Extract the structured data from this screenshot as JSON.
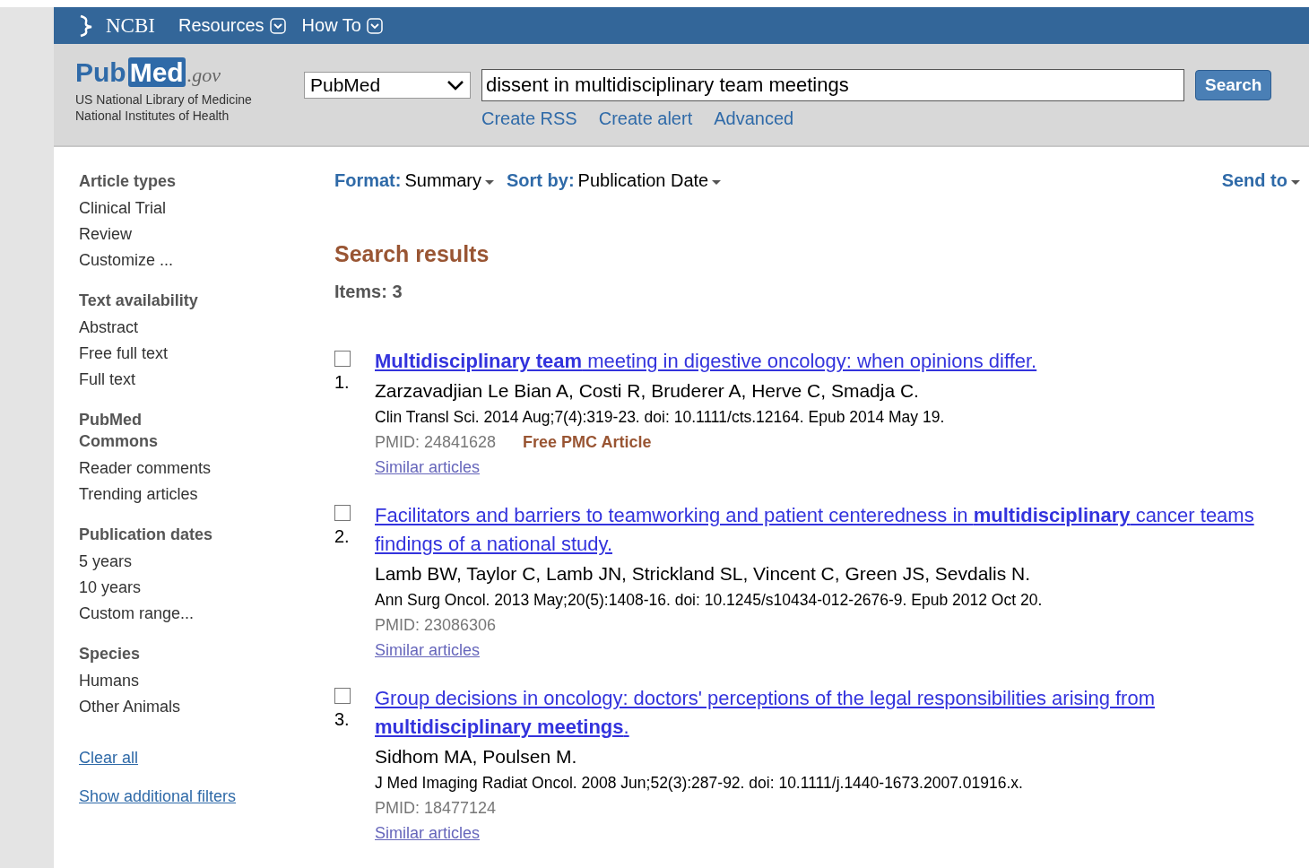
{
  "header": {
    "brand": "NCBI",
    "menus": [
      {
        "label": "Resources"
      },
      {
        "label": "How To"
      }
    ]
  },
  "logo": {
    "name_a": "Pub",
    "name_b": "Med",
    "suffix": ".gov",
    "lines": [
      "US National Library of Medicine",
      "National Institutes of Health"
    ]
  },
  "search": {
    "database": "PubMed",
    "query": "dissent in multidisciplinary team meetings",
    "button": "Search",
    "links": [
      "Create RSS",
      "Create alert",
      "Advanced"
    ]
  },
  "sidebar": {
    "groups": [
      {
        "title": "Article types",
        "items": [
          "Clinical Trial",
          "Review",
          "Customize ..."
        ]
      },
      {
        "title": "Text availability",
        "items": [
          "Abstract",
          "Free full text",
          "Full text"
        ]
      },
      {
        "title": "PubMed Commons",
        "items": [
          "Reader comments",
          "Trending articles"
        ]
      },
      {
        "title": "Publication dates",
        "items": [
          "5 years",
          "10 years",
          "Custom range..."
        ]
      },
      {
        "title": "Species",
        "items": [
          "Humans",
          "Other Animals"
        ]
      }
    ],
    "links": [
      "Clear all",
      "Show additional filters"
    ]
  },
  "toolbar": {
    "format_label": "Format:",
    "format_value": "Summary",
    "sort_label": "Sort by:",
    "sort_value": "Publication Date",
    "send": "Send to"
  },
  "results": {
    "heading": "Search results",
    "count": "Items: 3",
    "items": [
      {
        "number": "1.",
        "checked": false,
        "title": "**Multidisciplinary team** meeting in digestive oncology: when opinions differ.",
        "authors": "Zarzavadjian Le Bian A, Costi R, Bruderer A, Herve C, Smadja C.",
        "citation": "Clin Transl Sci. 2014 Aug;7(4):319-23. doi: 10.1111/cts.12164. Epub 2014 May 19.",
        "pmid": "PMID: 24841628",
        "free": "Free PMC Article",
        "similar": "Similar articles"
      },
      {
        "number": "2.",
        "checked": false,
        "title": "Facilitators and barriers to teamworking and patient centeredness in **multidisciplinary** cancer teams findings of a national study.",
        "authors": "Lamb BW, Taylor C, Lamb JN, Strickland SL, Vincent C, Green JS, Sevdalis N.",
        "citation": "Ann Surg Oncol. 2013 May;20(5):1408-16. doi: 10.1245/s10434-012-2676-9. Epub 2012 Oct 20.",
        "pmid": "PMID: 23086306",
        "similar": "Similar articles"
      },
      {
        "number": "3.",
        "checked": false,
        "title": "Group decisions in oncology: doctors' perceptions of the legal responsibilities arising from **multidisciplinary meetings**.",
        "authors": "Sidhom MA, Poulsen M.",
        "citation": "J Med Imaging Radiat Oncol. 2008 Jun;52(3):287-92. doi: 10.1111/j.1440-1673.2007.01916.x.",
        "pmid": "PMID: 18477124",
        "similar": "Similar articles"
      }
    ]
  }
}
